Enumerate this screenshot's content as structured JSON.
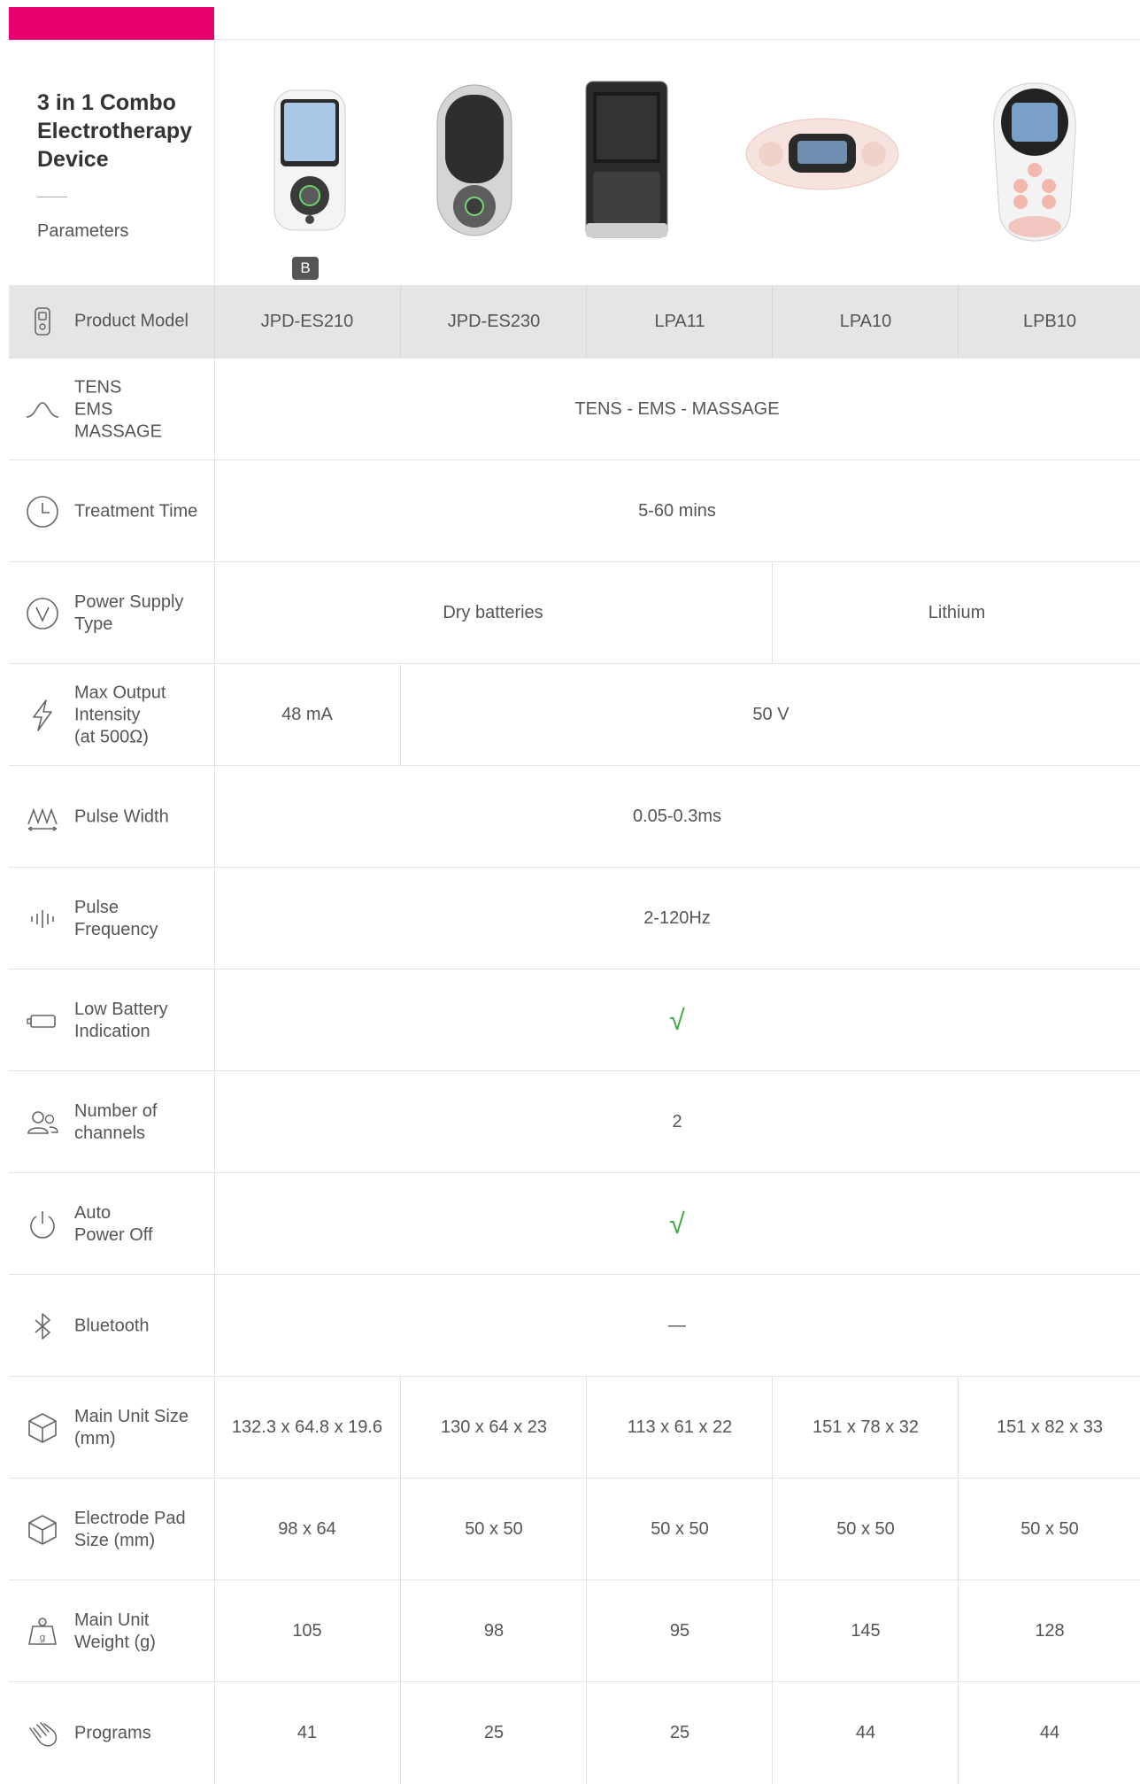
{
  "header": {
    "title": "3 in 1 Combo Electrotherapy Device",
    "subtitle": "Parameters",
    "badge": "B",
    "accent_color": "#e8006f"
  },
  "rows": {
    "model": {
      "icon": "device-icon",
      "label": "Product Model",
      "values": [
        "JPD-ES210",
        "JPD-ES230",
        "LPA11",
        "LPA10",
        "LPB10"
      ]
    },
    "mode": {
      "icon": "wave-icon",
      "label": "TENS\nEMS\nMASSAGE",
      "value": "TENS - EMS - MASSAGE"
    },
    "time": {
      "icon": "clock-icon",
      "label": "Treatment Time",
      "value": "5-60 mins"
    },
    "power": {
      "icon": "power-supply-icon",
      "label": "Power Supply\nType",
      "values": [
        "Dry batteries",
        "Lithium"
      ]
    },
    "output": {
      "icon": "lightning-icon",
      "label": "Max Output\nIntensity\n(at 500Ω)",
      "values": [
        "48 mA",
        "50 V"
      ]
    },
    "pulse_width": {
      "icon": "pulse-width-icon",
      "label": "Pulse Width",
      "value": "0.05-0.3ms"
    },
    "pulse_freq": {
      "icon": "frequency-icon",
      "label": "Pulse\nFrequency",
      "value": "2-120Hz"
    },
    "battery": {
      "icon": "battery-icon",
      "label": "Low Battery\nIndication",
      "value": "√"
    },
    "channels": {
      "icon": "users-icon",
      "label": "Number of\nchannels",
      "value": "2"
    },
    "auto_off": {
      "icon": "power-icon",
      "label": "Auto\nPower Off",
      "value": "√"
    },
    "bluetooth": {
      "icon": "bluetooth-icon",
      "label": "Bluetooth",
      "value": "—"
    },
    "unit_size": {
      "icon": "box-icon",
      "label": "Main Unit Size\n(mm)",
      "values": [
        "132.3 x 64.8 x 19.6",
        "130 x 64 x 23",
        "113 x 61 x 22",
        "151 x 78 x 32",
        "151 x 82 x 33"
      ]
    },
    "pad_size": {
      "icon": "box-icon",
      "label": "Electrode Pad\nSize (mm)",
      "values": [
        "98 x 64",
        "50 x 50",
        "50 x 50",
        "50 x 50",
        "50 x 50"
      ]
    },
    "weight": {
      "icon": "weight-icon",
      "label": "Main Unit\nWeight (g)",
      "values": [
        "105",
        "98",
        "95",
        "145",
        "128"
      ]
    },
    "programs": {
      "icon": "hand-icon",
      "label": "Programs",
      "values": [
        "41",
        "25",
        "25",
        "44",
        "44"
      ]
    }
  }
}
